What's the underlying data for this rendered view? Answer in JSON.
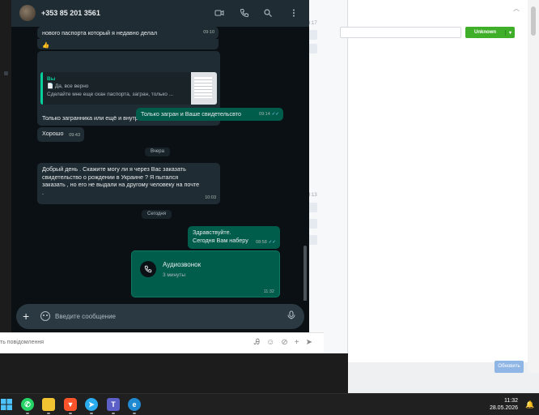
{
  "whatsapp": {
    "contact_name": "+353 85 201 3561",
    "header_icons": [
      "video-icon",
      "phone-icon",
      "search-icon",
      "menu-icon"
    ],
    "messages": [
      {
        "id": "m1",
        "direction": "in",
        "text": "нового паспорта который я недавно делал",
        "time": "09:10"
      },
      {
        "id": "m2",
        "direction": "in",
        "text": "👍",
        "time": ""
      },
      {
        "id": "m3",
        "direction": "in",
        "quote_author": "Вы",
        "quote_line1": "📄 Да, все верно",
        "quote_line2": "Сделайте мне еще скан паспорта, загран, только ...",
        "text": "Только загранника или ещё и внутреннего ?",
        "time": "09:10"
      },
      {
        "id": "m4",
        "direction": "out",
        "text": "Только загран и Ваше свидетельсвто",
        "time": "09:14"
      },
      {
        "id": "m5",
        "direction": "in",
        "text": "Хорошо",
        "time": "09:43"
      },
      {
        "id": "m6",
        "direction": "in",
        "text_line1": "Добрый день . Скажите могу ли я через Вас заказать",
        "text_line2": "свидетельство о рождении в Украине ? Я пытался",
        "text_line3": "заказать , но его не выдали на другому человеку на почте",
        "text_line4": ".",
        "time": "10:03"
      },
      {
        "id": "m7",
        "direction": "out",
        "text_line1": "Здравствуйте.",
        "text_line2": "Сегодня Вам наберу",
        "time": "08:58"
      }
    ],
    "day_separators": {
      "yesterday": "Вчера",
      "today": "Сегодня"
    },
    "call": {
      "title": "Аудиозвонок",
      "duration": "3 минуты",
      "time": "11:32"
    },
    "input_placeholder": "Введите сообщение",
    "accent_color": "#005c4b"
  },
  "background_app": {
    "status_button": "Unknown",
    "submit_button": "Обновить",
    "compose_placeholder": "ть повідомлення",
    "times": [
      "3:17",
      "3:13"
    ],
    "accent_green": "#3fae29"
  },
  "taskbar": {
    "apps": [
      "windows-start-icon",
      "whatsapp-icon",
      "file-explorer-icon",
      "brave-icon",
      "telegram-icon",
      "teams-icon",
      "edge-icon"
    ],
    "time": "11:32",
    "date": "28.05.2026"
  }
}
